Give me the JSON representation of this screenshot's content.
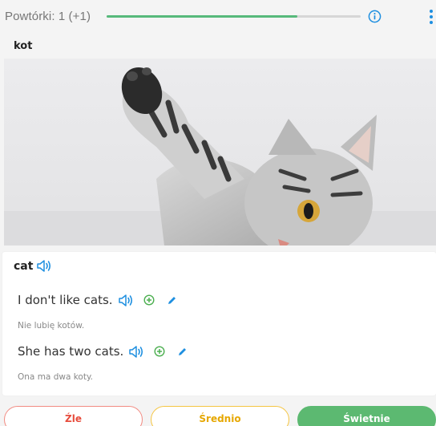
{
  "header": {
    "repetitions_label": "Powtórki: 1 (+1)",
    "progress_fraction": 0.75
  },
  "word": {
    "prompt": "kot",
    "answer": "cat"
  },
  "examples": [
    {
      "sentence": "I don't like cats.",
      "translation": "Nie lubię kotów."
    },
    {
      "sentence": "She has two cats.",
      "translation": "Ona ma dwa koty."
    }
  ],
  "rating_buttons": {
    "bad": "Źle",
    "medium": "Średnio",
    "good": "Świetnie"
  },
  "colors": {
    "accent_blue": "#1e8fe0",
    "progress_green": "#57b97b",
    "bad_red": "#e74c3c",
    "medium_yellow": "#e6a700",
    "good_green": "#5cb971"
  },
  "icons": {
    "info": "info-icon",
    "menu": "kebab-menu-icon",
    "audio": "speaker-icon",
    "add": "plus-circle-icon",
    "edit": "pencil-icon"
  }
}
